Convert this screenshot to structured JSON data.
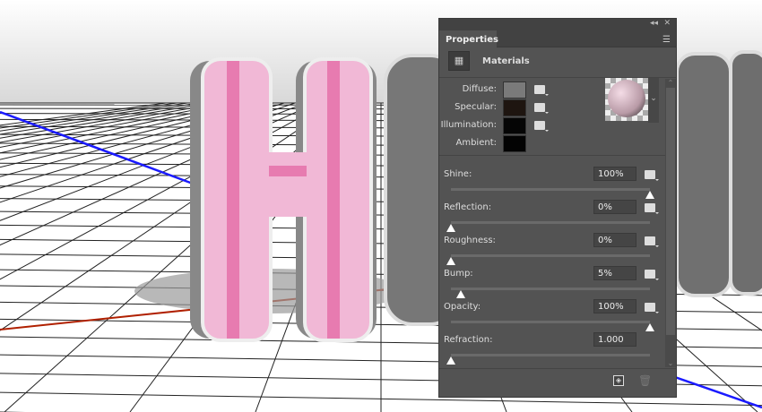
{
  "panel": {
    "title": "Properties",
    "collapse_icon": "double-chevron",
    "close_icon": "x",
    "section": "Materials",
    "swatches": [
      {
        "label": "Diffuse:",
        "color": "#7a7a7a"
      },
      {
        "label": "Specular:",
        "color": "#1e1510"
      },
      {
        "label": "Illumination:",
        "color": "#050505"
      },
      {
        "label": "Ambient:",
        "color": "#030303"
      }
    ],
    "sliders": [
      {
        "label": "Shine:",
        "value": "100%",
        "fraction": 1.0
      },
      {
        "label": "Reflection:",
        "value": "0%",
        "fraction": 0
      },
      {
        "label": "Roughness:",
        "value": "0%",
        "fraction": 0
      },
      {
        "label": "Bump:",
        "value": "5%",
        "fraction": 0.05
      },
      {
        "label": "Opacity:",
        "value": "100%",
        "fraction": 1.0
      },
      {
        "label": "Refraction:",
        "value": "1.000",
        "fraction": 0
      }
    ]
  },
  "colors": {
    "panel_bg": "#535353",
    "letter_pink": "#f1b8d6",
    "stripe": "#e77bb0"
  }
}
